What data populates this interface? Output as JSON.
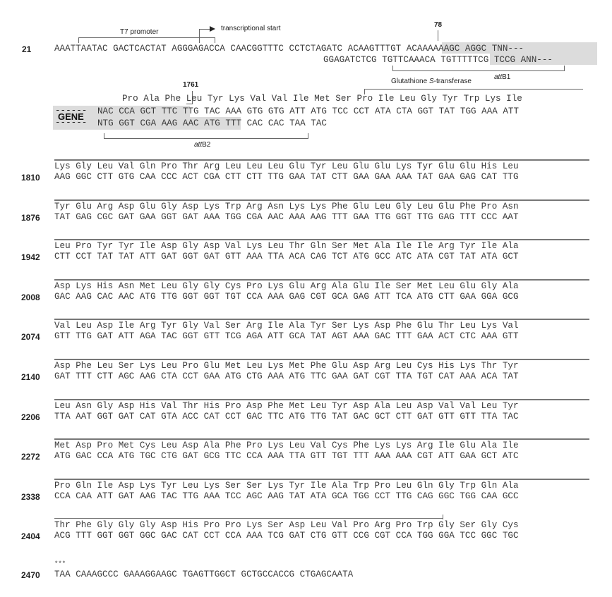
{
  "header": {
    "start_position": "21",
    "top_strand": "AAATTAATAC GACTCACTAT AGGGAGACCA CAACGGTTTC CCTCTAGATC ACAAGTTTGT ACAAAAAAGC AGGC TNN---",
    "bottom_strand": "GGAGATCTCG TGTTCAAACA TGTTTTTCG TCCG ANN---",
    "annotations": {
      "t7_promoter": "T7 promoter",
      "transcriptional_start": "transcriptional start",
      "position_78": "78",
      "gst": "Glutathione ",
      "gst_italic": "S",
      "gst_suffix": "-transferase",
      "attb1_italic": "att",
      "attb1_suffix": "B1"
    }
  },
  "gene_block": {
    "gene_label": "GENE",
    "dash_left": "------",
    "position_1761": "1761",
    "amino_acids": "Pro Ala Phe Leu Tyr Lys Val Val Ile Met Ser Pro Ile Leu Gly Tyr Trp Lys Ile",
    "top_strand": "NAC CCA GCT TTC TTG TAC AAA GTG GTG ATT ATG TCC CCT ATA CTA GGT TAT TGG AAA ATT",
    "bottom_strand": "NTG GGT CGA AAG AAC ATG TTT CAC CAC TAA TAC",
    "attb2_italic": "att",
    "attb2_suffix": "B2"
  },
  "codon_rows": [
    {
      "pos": "1810",
      "aa": "Lys Gly Leu Val Gln Pro Thr Arg Leu Leu Leu Glu Tyr Leu Glu Glu Lys Tyr Glu Glu His Leu",
      "nt": "AAG GGC CTT GTG CAA CCC ACT CGA CTT CTT TTG GAA TAT CTT GAA GAA AAA TAT GAA GAG CAT TTG"
    },
    {
      "pos": "1876",
      "aa": "Tyr Glu Arg Asp Glu Gly Asp Lys Trp Arg Asn Lys Lys Phe Glu Leu Gly Leu Glu Phe Pro Asn",
      "nt": "TAT GAG CGC GAT GAA GGT GAT AAA TGG CGA AAC AAA AAG TTT GAA TTG GGT TTG GAG TTT CCC AAT"
    },
    {
      "pos": "1942",
      "aa": "Leu Pro Tyr Tyr Ile Asp Gly Asp Val Lys Leu Thr Gln Ser Met Ala Ile Ile Arg Tyr Ile Ala",
      "nt": "CTT CCT TAT TAT ATT GAT GGT GAT GTT AAA TTA ACA CAG TCT ATG GCC ATC ATA CGT TAT ATA GCT"
    },
    {
      "pos": "2008",
      "aa": "Asp Lys His Asn Met Leu Gly Gly Cys Pro Lys Glu Arg Ala Glu Ile Ser Met Leu Glu Gly Ala",
      "nt": "GAC AAG CAC AAC ATG TTG GGT GGT TGT CCA AAA GAG CGT GCA GAG ATT TCA ATG CTT GAA GGA GCG"
    },
    {
      "pos": "2074",
      "aa": "Val Leu Asp Ile Arg Tyr Gly Val Ser Arg Ile Ala Tyr Ser Lys Asp Phe Glu Thr Leu Lys Val",
      "nt": "GTT TTG GAT ATT AGA TAC GGT GTT TCG AGA ATT GCA TAT AGT AAA GAC TTT GAA ACT CTC AAA GTT"
    },
    {
      "pos": "2140",
      "aa": "Asp Phe Leu Ser Lys Leu Pro Glu Met Leu Lys Met Phe Glu Asp Arg Leu Cys His Lys Thr Tyr",
      "nt": "GAT TTT CTT AGC AAG CTA CCT GAA ATG CTG AAA ATG TTC GAA GAT CGT TTA TGT CAT AAA ACA TAT"
    },
    {
      "pos": "2206",
      "aa": "Leu Asn Gly Asp His Val Thr His Pro Asp Phe Met Leu Tyr Asp Ala Leu Asp Val Val Leu Tyr",
      "nt": "TTA AAT GGT GAT CAT GTA ACC CAT CCT GAC TTC ATG TTG TAT GAC GCT CTT GAT GTT GTT TTA TAC"
    },
    {
      "pos": "2272",
      "aa": "Met Asp Pro Met Cys Leu Asp Ala Phe Pro Lys Leu Val Cys Phe Lys Lys Arg Ile Glu Ala Ile",
      "nt": "ATG GAC CCA ATG TGC CTG GAT GCG TTC CCA AAA TTA GTT TGT TTT AAA AAA CGT ATT GAA GCT ATC"
    },
    {
      "pos": "2338",
      "aa": "Pro Gln Ile Asp Lys Tyr Leu Lys Ser Ser Lys Tyr Ile Ala Trp Pro Leu Gln Gly Trp Gln Ala",
      "nt": "CCA CAA ATT GAT AAG TAC TTG AAA TCC AGC AAG TAT ATA GCA TGG CCT TTG CAG GGC TGG CAA GCC"
    },
    {
      "pos": "2404",
      "aa": "Thr Phe Gly Gly Gly Asp His Pro Pro Lys Ser Asp Leu Val Pro Arg Pro Trp Gly Ser Gly Cys",
      "nt": "ACG TTT GGT GGT GGC GAC CAT CCT CCA AAA TCG GAT CTG GTT CCG CGT CCA TGG GGA TCC GGC TGC"
    }
  ],
  "final_row": {
    "pos": "2470",
    "stop_marker": "***",
    "nt": "TAA CAAAGCCC GAAAGGAAGC TGAGTTGGCT GCTGCCACCG CTGAGCAATA"
  }
}
